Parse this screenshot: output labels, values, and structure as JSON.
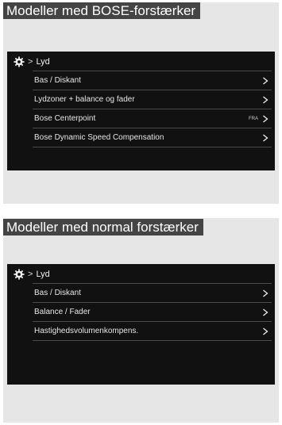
{
  "panels": [
    {
      "banner": "Modeller med BOSE-forstærker",
      "breadcrumb": {
        "icon": "gear-icon",
        "separator": ">",
        "label": "Lyd"
      },
      "items": [
        {
          "label": "Bas / Diskant",
          "extra": ""
        },
        {
          "label": "Lydzoner + balance og fader",
          "extra": ""
        },
        {
          "label": "Bose Centerpoint",
          "extra": "FRA"
        },
        {
          "label": "Bose Dynamic Speed Compensation",
          "extra": ""
        }
      ]
    },
    {
      "banner": "Modeller med normal forstærker",
      "breadcrumb": {
        "icon": "gear-icon",
        "separator": ">",
        "label": "Lyd"
      },
      "items": [
        {
          "label": "Bas / Diskant",
          "extra": ""
        },
        {
          "label": "Balance / Fader",
          "extra": ""
        },
        {
          "label": "Hastighedsvolumenkompens.",
          "extra": ""
        }
      ]
    }
  ],
  "colors": {
    "banner_bg": "#444444",
    "panel_bg": "#e6e6e6",
    "screen_bg": "#111111",
    "divider": "#4a4a4a"
  }
}
